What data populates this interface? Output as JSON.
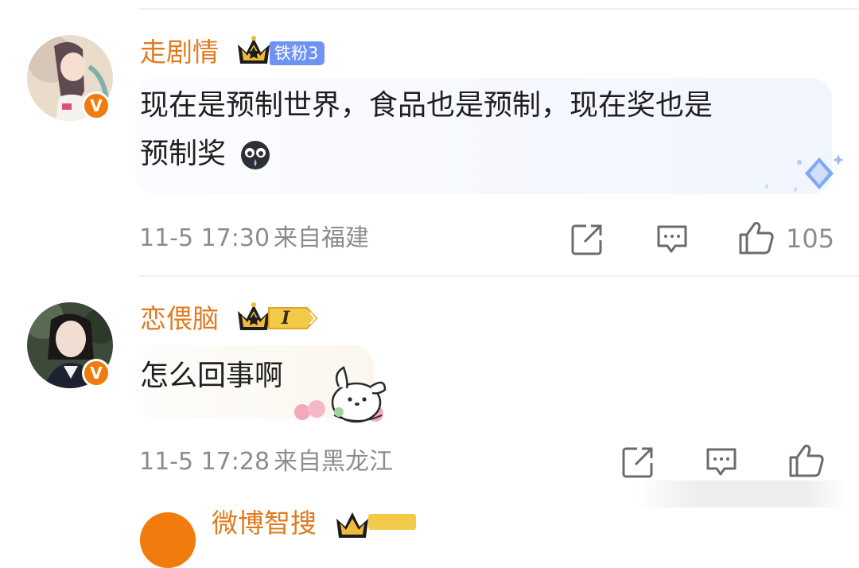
{
  "comments": [
    {
      "username": "走剧情",
      "fan_badge": "铁粉3",
      "verified_mark": "V",
      "text_line1": "现在是预制世界，食品也是预制，现在奖也是",
      "text_line2": "预制奖",
      "emoji_icon": "crying-face-emoji",
      "time": "11-5 17:30",
      "location": "来自福建",
      "likes": "105"
    },
    {
      "username": "恋偎脑",
      "level_badge": "I",
      "verified_mark": "V",
      "text_line1": "怎么回事啊",
      "time": "11-5 17:28",
      "location": "来自黑龙江",
      "likes": ""
    },
    {
      "username": "微博智搜"
    }
  ],
  "icons": {
    "share": "share-icon",
    "comment": "comment-icon",
    "like": "thumbs-up-icon",
    "crown": "crown-icon"
  },
  "colors": {
    "username": "#e07b1f",
    "fan_badge": "#6f93f2",
    "verified": "#f27b0e",
    "meta_gray": "#8c8c8c"
  }
}
